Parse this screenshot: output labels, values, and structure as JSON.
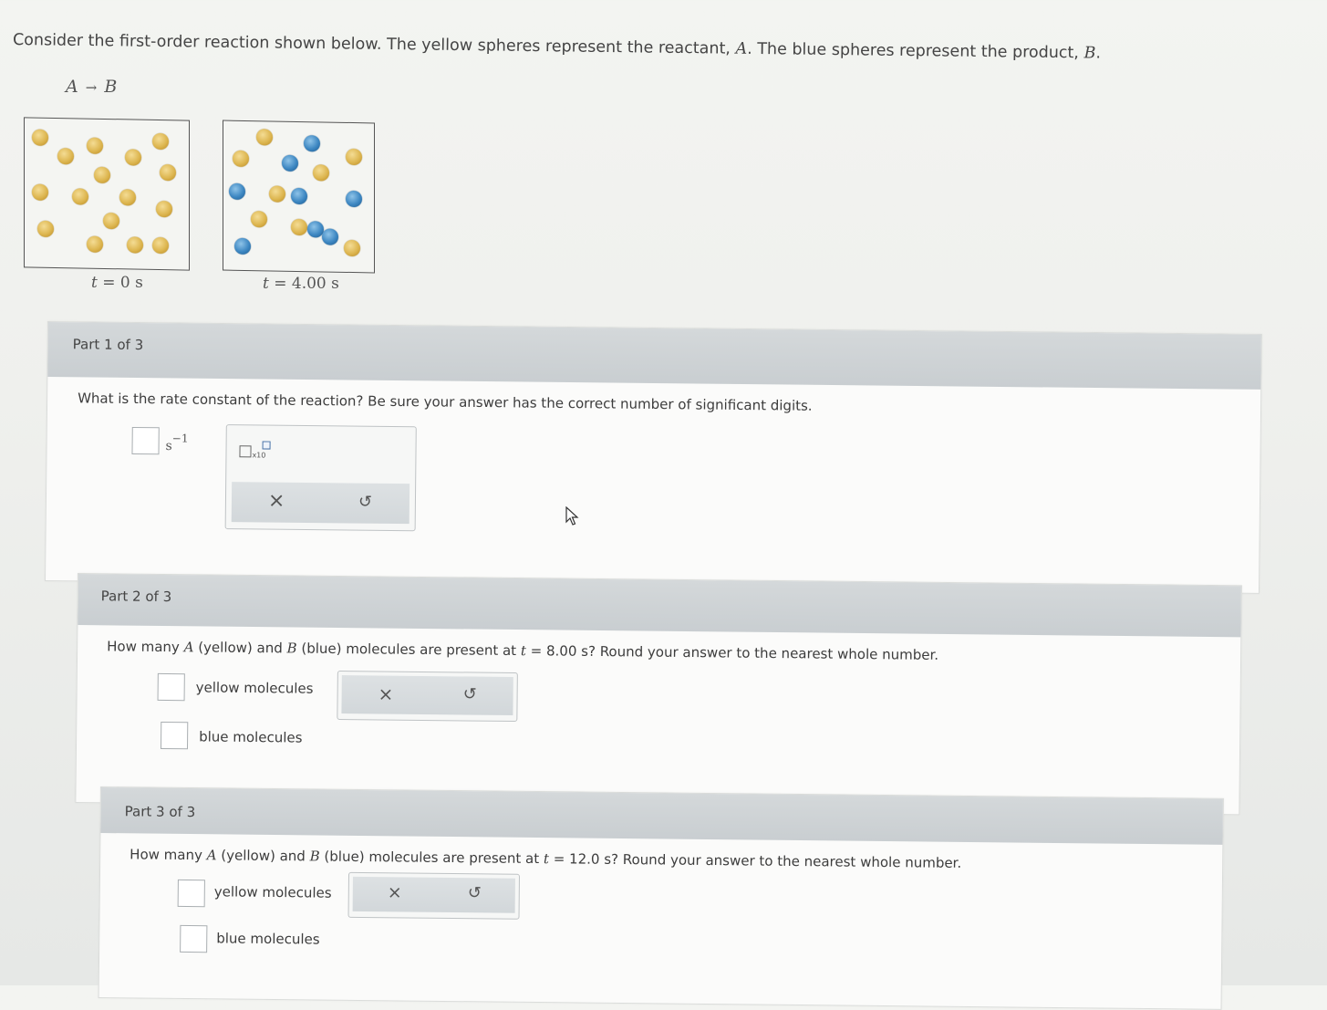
{
  "intro": {
    "prefix": "Consider the first-order reaction shown below. The yellow spheres represent the reactant,",
    "reactant": "A",
    "middle": ". The blue spheres represent the product,",
    "product": "B",
    "suffix": "."
  },
  "equation": {
    "reactant": "A",
    "arrow": "→",
    "product": "B"
  },
  "diagrams": [
    {
      "time_var": "t",
      "time_label": "= 0 s",
      "yellow_count": 16,
      "blue_count": 0
    },
    {
      "time_var": "t",
      "time_label": "= 4.00 s",
      "yellow_count": 8,
      "blue_count": 8
    }
  ],
  "parts": [
    {
      "title": "Part 1 of 3",
      "question": "What is the rate constant of the reaction? Be sure your answer has the correct number of significant digits.",
      "answer_value": "",
      "unit_base": "s",
      "unit_exp": "−1",
      "tools": {
        "sci_notation_label": "x10",
        "clear_icon": "×",
        "reset_icon": "↺"
      }
    },
    {
      "title": "Part 2 of 3",
      "question_prefix": "How many",
      "var_a": "A",
      "mid1": "(yellow) and",
      "var_b": "B",
      "mid2": "(blue) molecules are present at",
      "var_t": "t",
      "question_suffix": "= 8.00 s? Round your answer to the nearest whole number.",
      "fields": [
        {
          "label": "yellow molecules",
          "value": ""
        },
        {
          "label": "blue molecules",
          "value": ""
        }
      ],
      "tools": {
        "clear_icon": "×",
        "reset_icon": "↺"
      }
    },
    {
      "title": "Part 3 of 3",
      "question_prefix": "How many",
      "var_a": "A",
      "mid1": "(yellow) and",
      "var_b": "B",
      "mid2": "(blue) molecules are present at",
      "var_t": "t",
      "question_suffix": "= 12.0 s? Round your answer to the nearest whole number.",
      "fields": [
        {
          "label": "yellow molecules",
          "value": ""
        },
        {
          "label": "blue molecules",
          "value": ""
        }
      ],
      "tools": {
        "clear_icon": "×",
        "reset_icon": "↺"
      }
    }
  ],
  "colors": {
    "yellow_sphere": "#ddb650",
    "blue_sphere": "#3d87c2",
    "header_bar": "#cdd2d5"
  }
}
